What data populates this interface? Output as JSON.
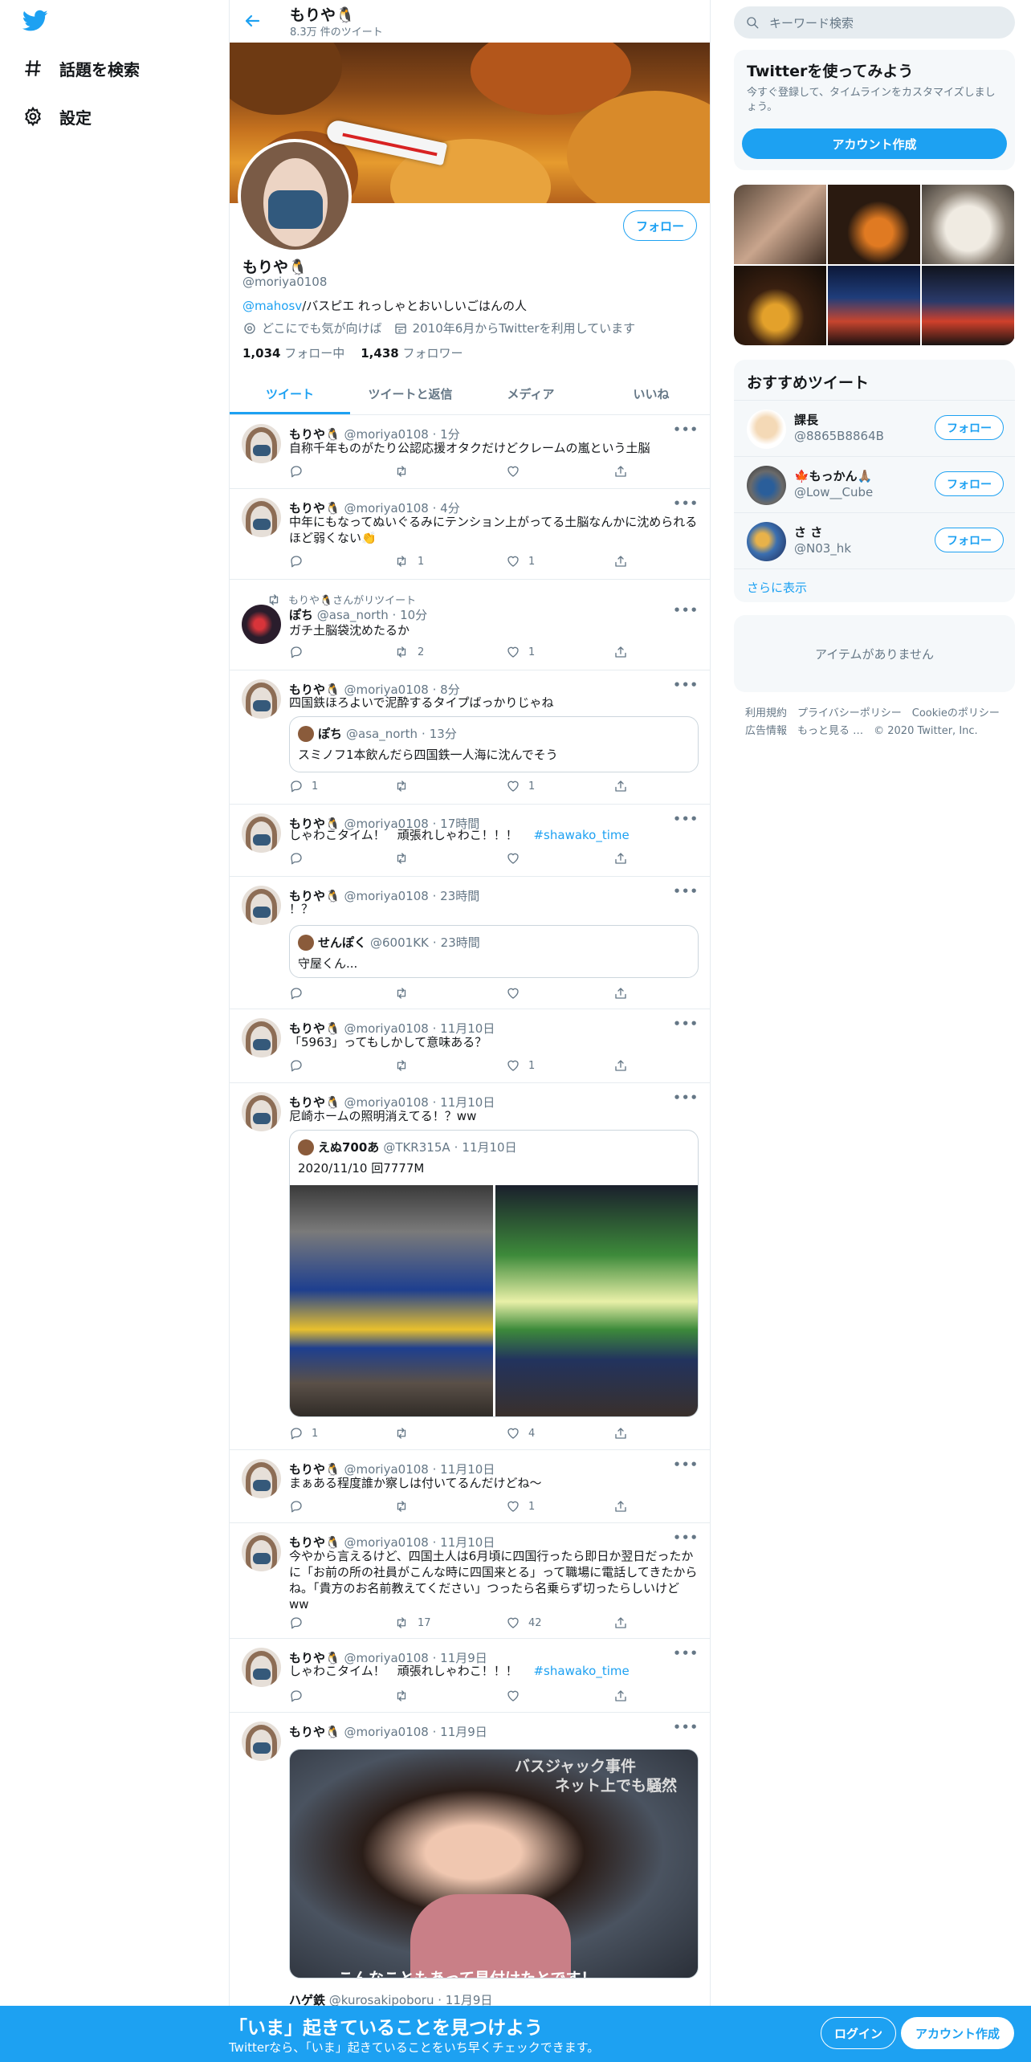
{
  "nav": {
    "explore": "話題を検索",
    "settings": "設定"
  },
  "header": {
    "name": "もりや🐧",
    "tweet_count": "8.3万 件のツイート"
  },
  "profile": {
    "name": "もりや🐧",
    "handle": "@moriya0108",
    "follow_label": "フォロー",
    "bio_mention": "@mahosv",
    "bio_text": "/バスピエ れっしゃとおいしいごはんの人",
    "location": "どこにでも気が向けば",
    "joined": "2010年6月からTwitterを利用しています",
    "following_count": "1,034",
    "following_label": "フォロー中",
    "followers_count": "1,438",
    "followers_label": "フォロワー"
  },
  "tabs": [
    "ツイート",
    "ツイートと返信",
    "メディア",
    "いいね"
  ],
  "tweets": [
    {
      "name": "もりや🐧",
      "handle": "@moriya0108",
      "time": "1分",
      "text": "自称千年ものがたり公認応援オタクだけどクレームの嵐という土脳",
      "reply": "",
      "retweet": "",
      "like": ""
    },
    {
      "name": "もりや🐧",
      "handle": "@moriya0108",
      "time": "4分",
      "text": "中年にもなってぬいぐるみにテンション上がってる土脳なんかに沈められるほど弱くない👏",
      "reply": "",
      "retweet": "1",
      "like": "1"
    },
    {
      "rt_label": "もりや🐧さんがリツイート",
      "name": "ぽち",
      "handle": "@asa_north",
      "time": "10分",
      "text": "ガチ土脳袋沈めたるか",
      "reply": "",
      "retweet": "2",
      "like": "1"
    },
    {
      "name": "もりや🐧",
      "handle": "@moriya0108",
      "time": "8分",
      "text": "四国鉄ほろよいで泥酔するタイプばっかりじゃね",
      "quote_name": "ぽち",
      "quote_handle": "@asa_north",
      "quote_time": "13分",
      "quote_text": "スミノフ1本飲んだら四国鉄一人海に沈んでそう",
      "reply": "1",
      "retweet": "",
      "like": "1"
    },
    {
      "name": "もりや🐧",
      "handle": "@moriya0108",
      "time": "17時間",
      "text": "しゃわこタイム！　頑張れしゃわこ！！！　",
      "hashtag": "#shawako_time",
      "reply": "",
      "retweet": "",
      "like": ""
    },
    {
      "name": "もりや🐧",
      "handle": "@moriya0108",
      "time": "23時間",
      "text": "！？",
      "quote_name": "せんぽく",
      "quote_handle": "@6001KK",
      "quote_time": "23時間",
      "quote_text": "守屋くん...",
      "reply": "",
      "retweet": "",
      "like": ""
    },
    {
      "name": "もりや🐧",
      "handle": "@moriya0108",
      "time": "11月10日",
      "text": "「5963」ってもしかして意味ある？",
      "reply": "",
      "retweet": "",
      "like": "1"
    },
    {
      "name": "もりや🐧",
      "handle": "@moriya0108",
      "time": "11月10日",
      "text": "尼崎ホームの照明消えてる！？ww",
      "quote_name": "えぬ700あ",
      "quote_handle": "@TKR315A",
      "quote_time": "11月10日",
      "quote_text": "2020/11/10 回7777M",
      "reply": "1",
      "retweet": "",
      "like": "4"
    },
    {
      "name": "もりや🐧",
      "handle": "@moriya0108",
      "time": "11月10日",
      "text": "まぁある程度誰か察しは付いてるんだけどね〜",
      "reply": "",
      "retweet": "",
      "like": "1"
    },
    {
      "name": "もりや🐧",
      "handle": "@moriya0108",
      "time": "11月10日",
      "text": "今やから言えるけど、四国土人は6月頃に四国行ったら即日か翌日だったかに「お前の所の社員がこんな時に四国来とる」って職場に電話してきたからね。「貴方のお名前教えてください」つったら名乗らず切ったらしいけどww",
      "reply": "",
      "retweet": "17",
      "like": "42"
    },
    {
      "name": "もりや🐧",
      "handle": "@moriya0108",
      "time": "11月9日",
      "text": "しゃわこタイム！　頑張れしゃわこ！！！　",
      "hashtag": "#shawako_time",
      "reply": "",
      "retweet": "",
      "like": ""
    },
    {
      "name": "もりや🐧",
      "handle": "@moriya0108",
      "time": "11月9日",
      "image_caption_1": "バスジャック事件",
      "image_caption_2": "ネット上でも騒然",
      "image_subtitle": "こんなこともあって見付けたとです！",
      "quote_name": "ハゲ鉄",
      "quote_handle": "@kurosakipoboru",
      "quote_time": "11月9日"
    }
  ],
  "right": {
    "search_placeholder": "キーワード検索",
    "signup_title": "Twitterを使ってみよう",
    "signup_text": "今すぐ登録して、タイムラインをカスタマイズしましょう。",
    "signup_button": "アカウント作成",
    "who_title": "おすすめツイート",
    "who": [
      {
        "name": "課長",
        "handle": "@8865B8864B",
        "follow": "フォロー"
      },
      {
        "name": "🍁もっかん🙏🏽",
        "handle": "@Low__Cube",
        "follow": "フォロー"
      },
      {
        "name": "さ さ",
        "handle": "@N03_hk",
        "follow": "フォロー"
      }
    ],
    "show_more": "さらに表示",
    "trends_empty": "アイテムがありません",
    "footer_1": "利用規約　プライバシーポリシー　Cookieのポリシー",
    "footer_2": "広告情報　もっと見る …　© 2020 Twitter, Inc."
  },
  "bottom": {
    "title": "「いま」起きていることを見つけよう",
    "subtitle": "Twitterなら、「いま」起きていることをいち早くチェックできます。",
    "login": "ログイン",
    "signup": "アカウント作成"
  },
  "colors": {
    "accent": "#1da1f2",
    "text": "#14171a",
    "muted": "#657786"
  }
}
